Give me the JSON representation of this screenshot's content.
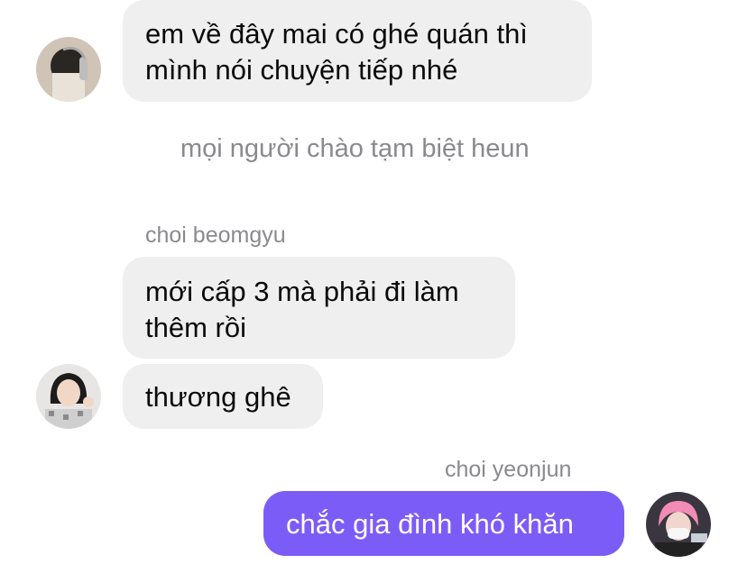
{
  "messages": [
    {
      "type": "incoming",
      "lines": [
        "em về đây mai có ghé quán thì",
        "mình nói chuyện tiếp nhé"
      ]
    },
    {
      "type": "system",
      "text": "mọi người chào tạm biệt heun"
    },
    {
      "type": "incoming",
      "sender": "choi beomgyu",
      "lines": [
        "mới cấp 3 mà phải đi làm",
        "thêm rồi"
      ]
    },
    {
      "type": "incoming",
      "lines": [
        "thương ghê"
      ]
    },
    {
      "type": "outgoing",
      "sender": "choi yeonjun",
      "lines": [
        "chắc gia đình khó khăn"
      ]
    }
  ],
  "colors": {
    "incoming_bubble": "#efefef",
    "outgoing_bubble": "#7c5cf6",
    "meta_text": "#8a8a8e"
  },
  "avatars": {
    "first": "avatar-headphones",
    "beomgyu": "avatar-beomgyu",
    "yeonjun": "avatar-yeonjun"
  }
}
